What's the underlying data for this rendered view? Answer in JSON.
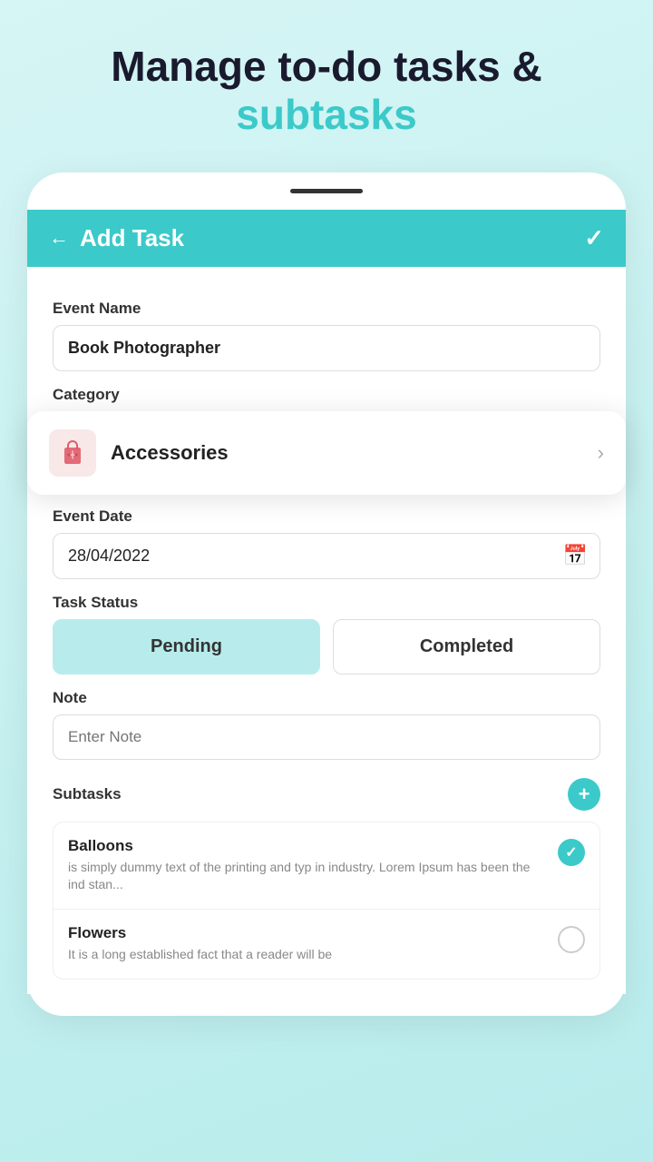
{
  "header": {
    "line1": "Manage to-do tasks &",
    "line2": "subtasks"
  },
  "topbar": {
    "title": "Add Task",
    "back_label": "←",
    "confirm_label": "✓"
  },
  "form": {
    "event_name_label": "Event Name",
    "event_name_value": "Book Photographer",
    "category_label": "Category",
    "category_value": "Accessories",
    "event_date_label": "Event Date",
    "event_date_value": "28/04/2022",
    "task_status_label": "Task Status",
    "status_pending": "Pending",
    "status_completed": "Completed",
    "note_label": "Note",
    "note_placeholder": "Enter Note",
    "subtasks_label": "Subtasks",
    "add_subtask_label": "+"
  },
  "subtasks": [
    {
      "name": "Balloons",
      "desc": "is simply dummy text of the printing and typ in industry. Lorem Ipsum has been the ind stan...",
      "checked": true
    },
    {
      "name": "Flowers",
      "desc": "It is a long established fact that a reader will be",
      "checked": false
    }
  ],
  "colors": {
    "teal": "#3cc9c9",
    "light_teal": "#b8ecec",
    "bg": "#d6f5f5"
  }
}
